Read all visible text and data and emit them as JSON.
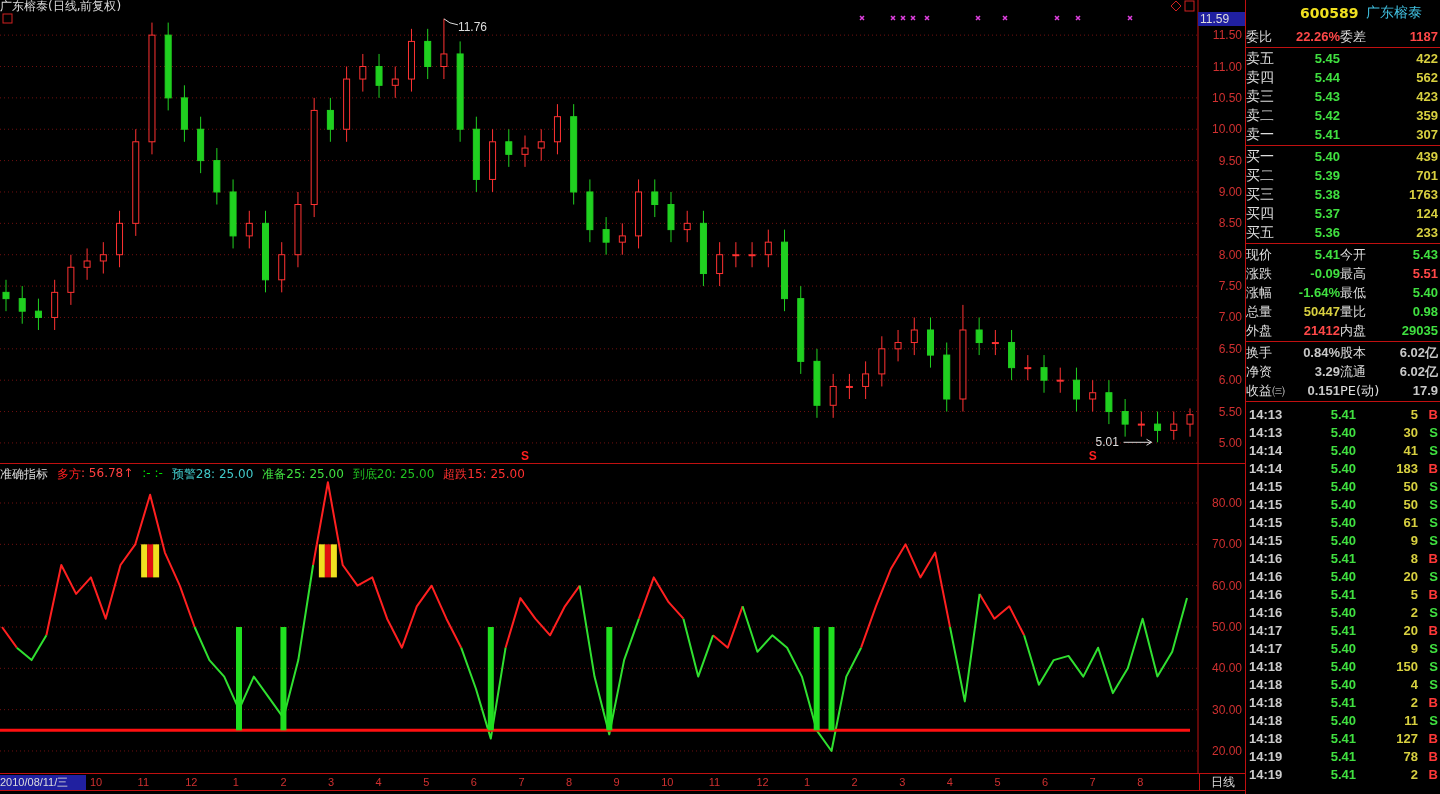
{
  "title": "广东榕泰(日线,前复权)",
  "price_chart": {
    "current_label": "11.59",
    "chart_data": {
      "type": "candlestick",
      "ohlc": [
        [
          7.4,
          7.6,
          7.1,
          7.3
        ],
        [
          7.3,
          7.5,
          6.9,
          7.1
        ],
        [
          7.1,
          7.3,
          6.8,
          7.0
        ],
        [
          7.0,
          7.6,
          6.8,
          7.4
        ],
        [
          7.4,
          8.0,
          7.2,
          7.8
        ],
        [
          7.8,
          8.1,
          7.6,
          7.9
        ],
        [
          7.9,
          8.2,
          7.7,
          8.0
        ],
        [
          8.0,
          8.7,
          7.8,
          8.5
        ],
        [
          8.5,
          10.0,
          8.3,
          9.8
        ],
        [
          9.8,
          11.7,
          9.6,
          11.5
        ],
        [
          11.5,
          11.7,
          10.3,
          10.5
        ],
        [
          10.5,
          10.7,
          9.8,
          10.0
        ],
        [
          10.0,
          10.2,
          9.3,
          9.5
        ],
        [
          9.5,
          9.7,
          8.8,
          9.0
        ],
        [
          9.0,
          9.2,
          8.1,
          8.3
        ],
        [
          8.3,
          8.7,
          8.1,
          8.5
        ],
        [
          8.5,
          8.7,
          7.4,
          7.6
        ],
        [
          7.6,
          8.2,
          7.4,
          8.0
        ],
        [
          8.0,
          9.0,
          7.8,
          8.8
        ],
        [
          8.8,
          10.5,
          8.6,
          10.3
        ],
        [
          10.3,
          10.5,
          9.8,
          10.0
        ],
        [
          10.0,
          11.0,
          9.8,
          10.8
        ],
        [
          10.8,
          11.2,
          10.6,
          11.0
        ],
        [
          11.0,
          11.2,
          10.5,
          10.7
        ],
        [
          10.7,
          11.0,
          10.5,
          10.8
        ],
        [
          10.8,
          11.6,
          10.6,
          11.4
        ],
        [
          11.4,
          11.6,
          10.8,
          11.0
        ],
        [
          11.0,
          11.76,
          10.8,
          11.2
        ],
        [
          11.2,
          11.4,
          9.8,
          10.0
        ],
        [
          10.0,
          10.2,
          9.0,
          9.2
        ],
        [
          9.2,
          10.0,
          9.0,
          9.8
        ],
        [
          9.8,
          10.0,
          9.4,
          9.6
        ],
        [
          9.6,
          9.9,
          9.4,
          9.7
        ],
        [
          9.7,
          10.0,
          9.5,
          9.8
        ],
        [
          9.8,
          10.4,
          9.6,
          10.2
        ],
        [
          10.2,
          10.4,
          8.8,
          9.0
        ],
        [
          9.0,
          9.2,
          8.2,
          8.4
        ],
        [
          8.4,
          8.6,
          8.0,
          8.2
        ],
        [
          8.2,
          8.5,
          8.0,
          8.3
        ],
        [
          8.3,
          9.2,
          8.1,
          9.0
        ],
        [
          9.0,
          9.2,
          8.6,
          8.8
        ],
        [
          8.8,
          9.0,
          8.2,
          8.4
        ],
        [
          8.4,
          8.7,
          8.2,
          8.5
        ],
        [
          8.5,
          8.7,
          7.5,
          7.7
        ],
        [
          7.7,
          8.2,
          7.5,
          8.0
        ],
        [
          8.0,
          8.2,
          7.8,
          8.0
        ],
        [
          8.0,
          8.2,
          7.8,
          8.0
        ],
        [
          8.0,
          8.4,
          7.8,
          8.2
        ],
        [
          8.2,
          8.4,
          7.1,
          7.3
        ],
        [
          7.3,
          7.5,
          6.1,
          6.3
        ],
        [
          6.3,
          6.5,
          5.4,
          5.6
        ],
        [
          5.6,
          6.1,
          5.4,
          5.9
        ],
        [
          5.9,
          6.1,
          5.7,
          5.9
        ],
        [
          5.9,
          6.3,
          5.7,
          6.1
        ],
        [
          6.1,
          6.7,
          5.9,
          6.5
        ],
        [
          6.5,
          6.8,
          6.3,
          6.6
        ],
        [
          6.6,
          7.0,
          6.4,
          6.8
        ],
        [
          6.8,
          7.0,
          6.2,
          6.4
        ],
        [
          6.4,
          6.6,
          5.5,
          5.7
        ],
        [
          5.7,
          7.2,
          5.5,
          6.8
        ],
        [
          6.8,
          7.0,
          6.4,
          6.6
        ],
        [
          6.6,
          6.8,
          6.4,
          6.6
        ],
        [
          6.6,
          6.8,
          6.0,
          6.2
        ],
        [
          6.2,
          6.4,
          6.0,
          6.2
        ],
        [
          6.2,
          6.4,
          5.8,
          6.0
        ],
        [
          6.0,
          6.2,
          5.8,
          6.0
        ],
        [
          6.0,
          6.2,
          5.5,
          5.7
        ],
        [
          5.7,
          6.0,
          5.5,
          5.8
        ],
        [
          5.8,
          6.0,
          5.3,
          5.5
        ],
        [
          5.5,
          5.7,
          5.1,
          5.3
        ],
        [
          5.3,
          5.5,
          5.1,
          5.3
        ],
        [
          5.3,
          5.5,
          5.01,
          5.2
        ],
        [
          5.2,
          5.5,
          5.05,
          5.3
        ],
        [
          5.3,
          5.55,
          5.1,
          5.45
        ]
      ],
      "ylim": [
        4.68,
        12.06
      ],
      "grid": true,
      "yticks": [
        {
          "value": 11.5,
          "label": "11.50"
        },
        {
          "value": 11,
          "label": "11.00"
        },
        {
          "value": 10.5,
          "label": "10.50"
        },
        {
          "value": 10,
          "label": "10.00"
        },
        {
          "value": 9.5,
          "label": "9.50"
        },
        {
          "value": 9,
          "label": "9.00"
        },
        {
          "value": 8.5,
          "label": "8.50"
        },
        {
          "value": 8,
          "label": "8.00"
        },
        {
          "value": 7.5,
          "label": "7.50"
        },
        {
          "value": 7,
          "label": "7.00"
        },
        {
          "value": 6.5,
          "label": "6.50"
        },
        {
          "value": 6,
          "label": "6.00"
        },
        {
          "value": 5.5,
          "label": "5.50"
        },
        {
          "value": 5,
          "label": "5.00"
        }
      ],
      "annotations": [
        "11.76",
        "5.01",
        "S",
        "S"
      ]
    }
  },
  "indicator": {
    "name": "准确指标",
    "legend": [
      {
        "text": ": 56.78↑",
        "color": "#ff4040"
      },
      {
        "text": ":- :-",
        "color": "#00e000"
      },
      {
        "text": "预警28: 25.00",
        "color": "#40c8c8"
      },
      {
        "text": "准备25: 25.00",
        "color": "#40e040"
      },
      {
        "text": "到底20: 25.00",
        "color": "#20c020"
      },
      {
        "text": "超跌15: 25.00",
        "color": "#ff3030"
      }
    ],
    "chart_data": {
      "type": "line",
      "ylim": [
        14.67,
        89.68
      ],
      "grid": true,
      "series": [
        {
          "name": "多方",
          "color": "#ff2020",
          "values": [
            50,
            45,
            null,
            48,
            65,
            58,
            62,
            52,
            65,
            70,
            82,
            68,
            60,
            50,
            null,
            null,
            null,
            null,
            null,
            null,
            null,
            65,
            85,
            65,
            60,
            62,
            52,
            45,
            55,
            60,
            52,
            45,
            null,
            null,
            45,
            57,
            52,
            48,
            55,
            60,
            null,
            null,
            null,
            52,
            62,
            56,
            52,
            null,
            48,
            45,
            55,
            null,
            null,
            null,
            null,
            null,
            null,
            null,
            45,
            55,
            64,
            70,
            62,
            68,
            50,
            null,
            58,
            52,
            55,
            48,
            null,
            null,
            null,
            null,
            null,
            null,
            null,
            null,
            null,
            null,
            null
          ]
        },
        {
          "color": "#30e030",
          "values": [
            null,
            45,
            42,
            48,
            null,
            null,
            null,
            null,
            null,
            null,
            null,
            null,
            null,
            50,
            42,
            38,
            30,
            38,
            33,
            28,
            42,
            65,
            null,
            null,
            null,
            null,
            null,
            null,
            null,
            null,
            null,
            45,
            35,
            23,
            45,
            null,
            null,
            null,
            null,
            60,
            38,
            24,
            42,
            52,
            null,
            null,
            52,
            38,
            48,
            null,
            55,
            44,
            48,
            45,
            38,
            25,
            20,
            38,
            45,
            null,
            null,
            null,
            null,
            null,
            50,
            32,
            58,
            null,
            null,
            48,
            36,
            42,
            43,
            38,
            45,
            34,
            40,
            52,
            38,
            44,
            57
          ]
        }
      ],
      "yticks": [
        {
          "value": 80,
          "label": "80.00"
        },
        {
          "value": 70,
          "label": "70.00"
        },
        {
          "value": 60,
          "label": "60.00"
        },
        {
          "value": 50,
          "label": "50.00"
        },
        {
          "value": 40,
          "label": "40.00"
        },
        {
          "value": 30,
          "label": "30.00"
        },
        {
          "value": 20,
          "label": "20.00"
        }
      ]
    }
  },
  "time_axis": {
    "date": "2010/08/11/三",
    "months": [
      "10",
      "11",
      "12",
      "1",
      "2",
      "3",
      "4",
      "5",
      "6",
      "7",
      "8",
      "9",
      "10",
      "11",
      "12",
      "1",
      "2",
      "3",
      "4",
      "5",
      "6",
      "7",
      "8"
    ],
    "period": "日线"
  },
  "quote": {
    "code": "600589",
    "name": "广东榕泰",
    "ratio": [
      {
        "label": "委比",
        "value": "22.26%",
        "color": "#ff4848"
      },
      {
        "label": "委差",
        "value": "1187",
        "color": "#ff4848"
      }
    ],
    "asks": [
      {
        "label": "卖五",
        "price": "5.45",
        "volume": "422"
      },
      {
        "label": "卖四",
        "price": "5.44",
        "volume": "562"
      },
      {
        "label": "卖三",
        "price": "5.43",
        "volume": "423"
      },
      {
        "label": "卖二",
        "price": "5.42",
        "volume": "359"
      },
      {
        "label": "卖一",
        "price": "5.41",
        "volume": "307"
      }
    ],
    "bids": [
      {
        "label": "买一",
        "price": "5.40",
        "volume": "439"
      },
      {
        "label": "买二",
        "price": "5.39",
        "volume": "701"
      },
      {
        "label": "买三",
        "price": "5.38",
        "volume": "1763"
      },
      {
        "label": "买四",
        "price": "5.37",
        "volume": "124"
      },
      {
        "label": "买五",
        "price": "5.36",
        "volume": "233"
      }
    ],
    "stats": [
      {
        "label": "现价",
        "value": "5.41",
        "color": "#40e040"
      },
      {
        "label": "今开",
        "value": "5.43",
        "color": "#40e040"
      },
      {
        "label": "涨跌",
        "value": "-0.09",
        "color": "#40e040"
      },
      {
        "label": "最高",
        "value": "5.51",
        "color": "#ff4848"
      },
      {
        "label": "涨幅",
        "value": "-1.64%",
        "color": "#40e040"
      },
      {
        "label": "最低",
        "value": "5.40",
        "color": "#40e040"
      },
      {
        "label": "总量",
        "value": "50447",
        "color": "#d8d040"
      },
      {
        "label": "量比",
        "value": "0.98",
        "color": "#40e040"
      },
      {
        "label": "外盘",
        "value": "21412",
        "color": "#ff4848"
      },
      {
        "label": "内盘",
        "value": "29035",
        "color": "#40e040"
      }
    ],
    "fundamentals": [
      {
        "label": "换手",
        "value": "0.84%"
      },
      {
        "label": "股本",
        "value": "6.02亿"
      },
      {
        "label": "净资",
        "value": "3.29"
      },
      {
        "label": "流通",
        "value": "6.02亿"
      },
      {
        "label": "收益㈢",
        "value": "0.151"
      },
      {
        "label": "PE(动)",
        "value": "17.9"
      }
    ],
    "trades": [
      {
        "time": "14:13",
        "price": "5.41",
        "volume": "5",
        "side": "B",
        "kind": "buy"
      },
      {
        "time": "14:13",
        "price": "5.40",
        "volume": "30",
        "side": "S",
        "kind": "sell"
      },
      {
        "time": "14:14",
        "price": "5.40",
        "volume": "41",
        "side": "S",
        "kind": "sell"
      },
      {
        "time": "14:14",
        "price": "5.40",
        "volume": "183",
        "side": "B",
        "kind": "buy"
      },
      {
        "time": "14:15",
        "price": "5.40",
        "volume": "50",
        "side": "S",
        "kind": "sell"
      },
      {
        "time": "14:15",
        "price": "5.40",
        "volume": "50",
        "side": "S",
        "kind": "sell"
      },
      {
        "time": "14:15",
        "price": "5.40",
        "volume": "61",
        "side": "S",
        "kind": "sell"
      },
      {
        "time": "14:15",
        "price": "5.40",
        "volume": "9",
        "side": "S",
        "kind": "sell"
      },
      {
        "time": "14:16",
        "price": "5.41",
        "volume": "8",
        "side": "B",
        "kind": "buy"
      },
      {
        "time": "14:16",
        "price": "5.40",
        "volume": "20",
        "side": "S",
        "kind": "sell"
      },
      {
        "time": "14:16",
        "price": "5.41",
        "volume": "5",
        "side": "B",
        "kind": "buy"
      },
      {
        "time": "14:16",
        "price": "5.40",
        "volume": "2",
        "side": "S",
        "kind": "sell"
      },
      {
        "time": "14:17",
        "price": "5.41",
        "volume": "20",
        "side": "B",
        "kind": "buy"
      },
      {
        "time": "14:17",
        "price": "5.40",
        "volume": "9",
        "side": "S",
        "kind": "sell"
      },
      {
        "time": "14:18",
        "price": "5.40",
        "volume": "150",
        "side": "S",
        "kind": "sell"
      },
      {
        "time": "14:18",
        "price": "5.40",
        "volume": "4",
        "side": "S",
        "kind": "sell"
      },
      {
        "time": "14:18",
        "price": "5.41",
        "volume": "2",
        "side": "B",
        "kind": "buy"
      },
      {
        "time": "14:18",
        "price": "5.40",
        "volume": "11",
        "side": "S",
        "kind": "sell"
      },
      {
        "time": "14:18",
        "price": "5.41",
        "volume": "127",
        "side": "B",
        "kind": "buy"
      },
      {
        "time": "14:19",
        "price": "5.41",
        "volume": "78",
        "side": "B",
        "kind": "buy"
      },
      {
        "time": "14:19",
        "price": "5.41",
        "volume": "2",
        "side": "B",
        "kind": "buy"
      }
    ]
  }
}
